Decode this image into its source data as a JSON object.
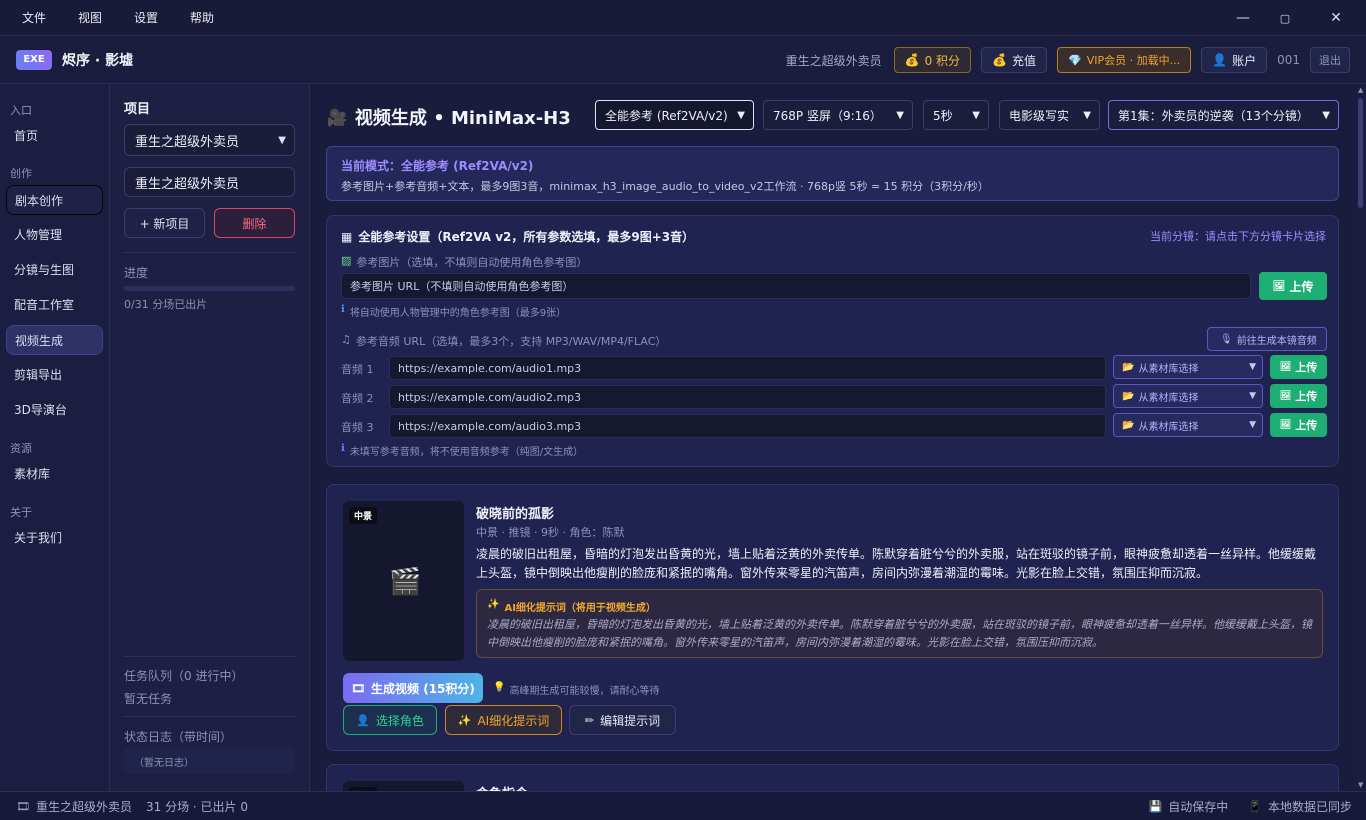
{
  "menu": {
    "file": "文件",
    "view": "视图",
    "settings": "设置",
    "help": "帮助"
  },
  "window": {
    "minimize": "—",
    "maximize": "▢",
    "close": "✕"
  },
  "header": {
    "logo": "EXE",
    "app_title": "烬序 · 影墟",
    "project_name": "重生之超级外卖员",
    "points": "0 积分",
    "recharge": "充值",
    "vip": "VIP会员 · 加载中...",
    "account": "账户",
    "user_id": "001",
    "logout": "退出"
  },
  "sidebar": {
    "sections": {
      "entry": "入口",
      "create": "创作",
      "resource": "资源",
      "about": "关于"
    },
    "items": {
      "home": "首页",
      "script": "剧本创作",
      "characters": "人物管理",
      "storyboard": "分镜与生图",
      "dubbing": "配音工作室",
      "video": "视频生成",
      "edit": "剪辑导出",
      "director": "3D导演台",
      "materials": "素材库",
      "about_us": "关于我们"
    }
  },
  "project_panel": {
    "title": "项目",
    "selected_project": "重生之超级外卖员",
    "name_value": "重生之超级外卖员",
    "new_project": "+ 新项目",
    "delete": "删除",
    "progress_label": "进度",
    "progress_value": 0,
    "progress_text": "0/31 分场已出片",
    "queue_label": "任务队列（0 进行中）",
    "queue_empty": "暂无任务",
    "log_label": "状态日志（带时间）",
    "log_empty": "（暂无日志）"
  },
  "main": {
    "title": "视频生成 • MiniMax-H3",
    "mode_select": "全能参考 (Ref2VA/v2)",
    "resolution_select": "768P 竖屏（9:16）",
    "duration_select": "5秒",
    "style_select": "电影级写实",
    "episode_select": "第1集：外卖员的逆袭（13个分镜）",
    "mode_box": {
      "label": "当前模式：全能参考 (Ref2VA/v2)",
      "desc": "参考图片+参考音频+文本，最多9图3音，minimax_h3_image_audio_to_video_v2工作流 · 768p竖 5秒 = 15 积分（3积分/秒）"
    },
    "ref_card": {
      "title": "全能参考设置（Ref2VA v2，所有参数选填，最多9图+3音）",
      "current_shot": "当前分镜：请点击下方分镜卡片选择",
      "image_label": "参考图片（选填，不填则自动使用角色参考图）",
      "image_placeholder": "参考图片 URL（不填则自动使用角色参考图）",
      "upload": "上传",
      "image_note": "将自动使用人物管理中的角色参考图（最多9张）",
      "audio_label": "参考音频 URL（选填，最多3个，支持 MP3/WAV/MP4/FLAC）",
      "goto_dubbing": "前往生成本镜音频",
      "audios": [
        {
          "label": "音频 1",
          "url": "https://example.com/audio1.mp3",
          "select": "从素材库选择",
          "upload": "上传"
        },
        {
          "label": "音频 2",
          "url": "https://example.com/audio2.mp3",
          "select": "从素材库选择",
          "upload": "上传"
        },
        {
          "label": "音频 3",
          "url": "https://example.com/audio3.mp3",
          "select": "从素材库选择",
          "upload": "上传"
        }
      ],
      "audio_note": "未填写参考音频，将不使用音频参考（纯图/文生成）"
    },
    "shot": {
      "tag": "中景",
      "title": "破晓前的孤影",
      "meta": "中景 · 推镜 · 9秒 · 角色：陈默",
      "desc": "凌晨的破旧出租屋，昏暗的灯泡发出昏黄的光，墙上贴着泛黄的外卖传单。陈默穿着脏兮兮的外卖服，站在斑驳的镜子前，眼神疲惫却透着一丝异样。他缓缓戴上头盔，镜中倒映出他瘦削的脸庞和紧抿的嘴角。窗外传来零星的汽笛声，房间内弥漫着潮湿的霉味。光影在脸上交错，氛围压抑而沉寂。",
      "ai_title": "AI细化提示词（将用于视频生成）",
      "ai_text": "凌晨的破旧出租屋，昏暗的灯泡发出昏黄的光，墙上贴着泛黄的外卖传单。陈默穿着脏兮兮的外卖服，站在斑驳的镜子前，眼神疲惫却透着一丝异样。他缓缓戴上头盔，镜中倒映出他瘦削的脸庞和紧抿的嘴角。窗外传来零星的汽笛声，房间内弥漫着潮湿的霉味。光影在脸上交错，氛围压抑而沉寂。",
      "generate": "生成视频 (15积分)",
      "generate_hint": "高峰期生成可能较慢，请耐心等待",
      "choose_character": "选择角色",
      "ai_refine": "AI细化提示词",
      "edit_prompt": "编辑提示词"
    },
    "next_shot": {
      "tag": "特写",
      "title": "命鱼指令"
    }
  },
  "statusbar": {
    "project": "重生之超级外卖员",
    "stats": "31 分场 · 已出片 0",
    "autosave": "自动保存中",
    "synced": "本地数据已同步"
  },
  "colors": {
    "accent": "#7b6cf0",
    "green": "#1dae73",
    "orange": "#f0a72e",
    "danger": "#e0425f"
  }
}
